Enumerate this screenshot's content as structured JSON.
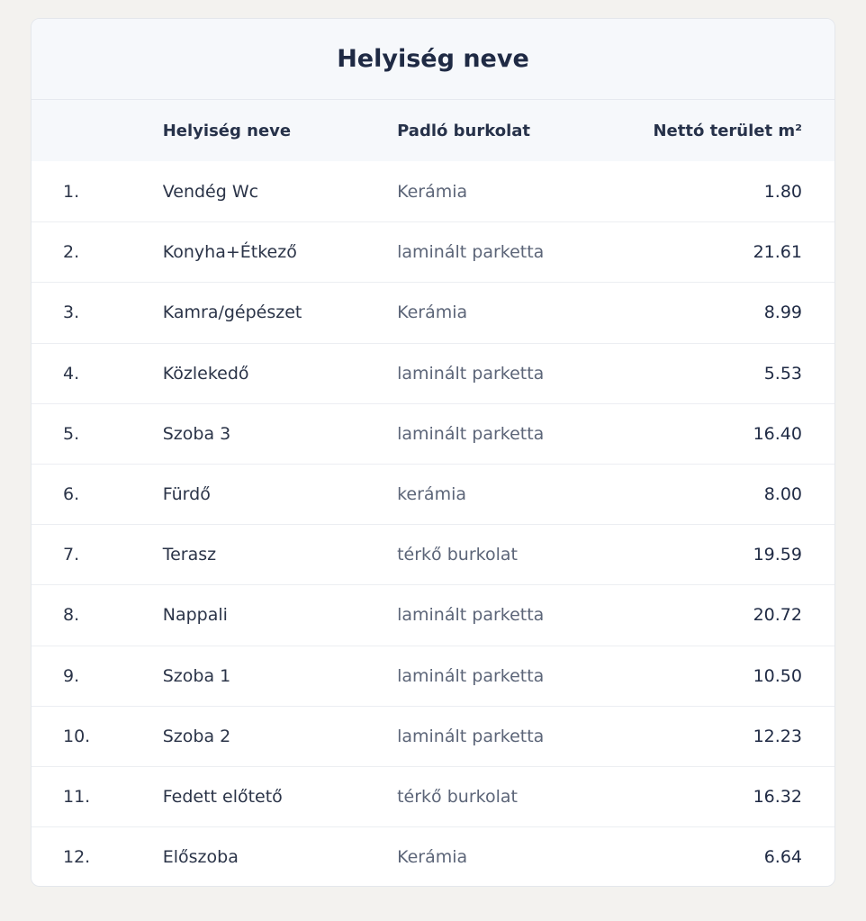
{
  "table": {
    "title": "Helyiség neve",
    "headers": {
      "index": "",
      "name": "Helyiség neve",
      "floor": "Padló burkolat",
      "area": "Nettó terület m²"
    },
    "rows": [
      {
        "index": "1.",
        "name": "Vendég Wc",
        "floor": "Kerámia",
        "area": "1.80"
      },
      {
        "index": "2.",
        "name": "Konyha+Étkező",
        "floor": "laminált parketta",
        "area": "21.61"
      },
      {
        "index": "3.",
        "name": "Kamra/gépészet",
        "floor": "Kerámia",
        "area": "8.99"
      },
      {
        "index": "4.",
        "name": "Közlekedő",
        "floor": "laminált parketta",
        "area": "5.53"
      },
      {
        "index": "5.",
        "name": "Szoba 3",
        "floor": "laminált parketta",
        "area": "16.40"
      },
      {
        "index": "6.",
        "name": "Fürdő",
        "floor": "kerámia",
        "area": "8.00"
      },
      {
        "index": "7.",
        "name": "Terasz",
        "floor": "térkő burkolat",
        "area": "19.59"
      },
      {
        "index": "8.",
        "name": "Nappali",
        "floor": "laminált parketta",
        "area": "20.72"
      },
      {
        "index": "9.",
        "name": "Szoba 1",
        "floor": "laminált parketta",
        "area": "10.50"
      },
      {
        "index": "10.",
        "name": "Szoba 2",
        "floor": "laminált parketta",
        "area": "12.23"
      },
      {
        "index": "11.",
        "name": "Fedett előtető",
        "floor": "térkő burkolat",
        "area": "16.32"
      },
      {
        "index": "12.",
        "name": "Előszoba",
        "floor": "Kerámia",
        "area": "6.64"
      }
    ]
  },
  "colors": {
    "page_background": "#f3f2ef",
    "card_background": "#ffffff",
    "header_background": "#f6f8fb",
    "title_text": "#1f2a44",
    "secondary_text": "#5c6578"
  }
}
